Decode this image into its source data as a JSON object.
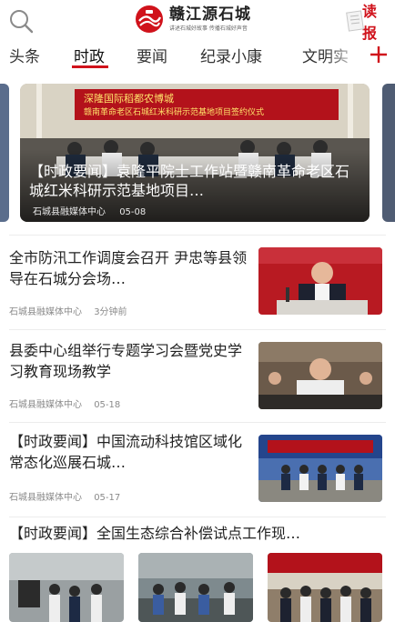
{
  "header": {
    "logo_title": "赣江源石城",
    "logo_sub": "讲述石城好故事 传播石城好声音",
    "report_label": "读报",
    "colors": {
      "brand_red": "#d0121b"
    }
  },
  "tabs": [
    {
      "label": "头条",
      "active": false
    },
    {
      "label": "时政",
      "active": true
    },
    {
      "label": "要闻",
      "active": false
    },
    {
      "label": "纪录小康",
      "active": false
    },
    {
      "label": "文明实",
      "active": false
    }
  ],
  "banner": {
    "title": "【时政要闻】袁隆平院士工作站暨赣南革命老区石城红米科研示范基地项目…",
    "source": "石城县融媒体中心",
    "date": "05-08",
    "image_text_line1": "深隆国际稻都农博城",
    "image_text_line2": "赣南革命老区石城红米科研示范基地项目签约仪式"
  },
  "news": [
    {
      "title": "全市防汛工作调度会召开 尹忠等县领导在石城分会场…",
      "source": "石城县融媒体中心",
      "time": "3分钟前"
    },
    {
      "title": "县委中心组举行专题学习会暨党史学习教育现场教学",
      "source": "石城县融媒体中心",
      "time": "05-18"
    },
    {
      "title": "【时政要闻】中国流动科技馆区域化常态化巡展石城…",
      "source": "石城县融媒体中心",
      "time": "05-17"
    }
  ],
  "triple": {
    "title": "【时政要闻】全国生态综合补偿试点工作现…"
  },
  "icons": {
    "search": "search-icon",
    "add": "plus-icon",
    "report": "newspaper-icon"
  }
}
